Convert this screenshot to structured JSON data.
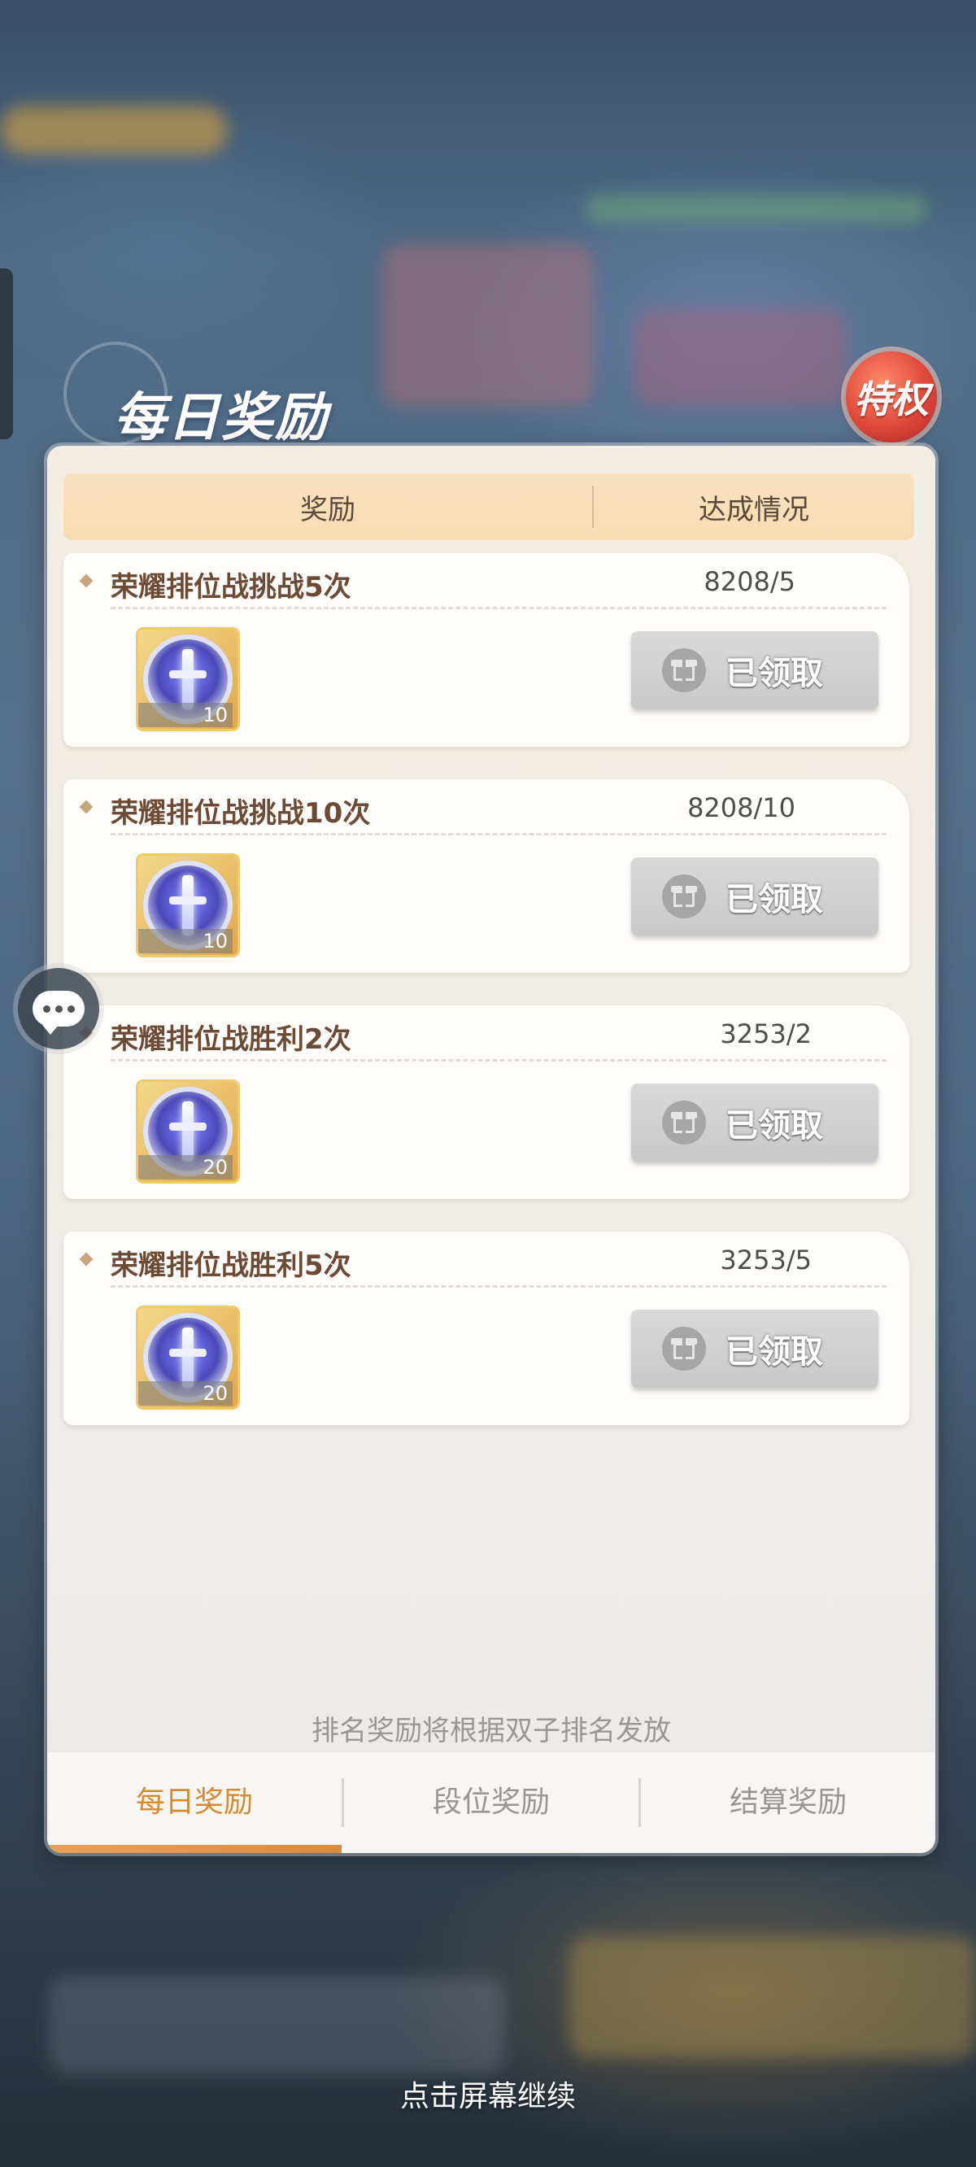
{
  "panel": {
    "title": "每日奖励",
    "privilege_badge": "特权",
    "header": {
      "reward": "奖励",
      "status": "达成情况"
    }
  },
  "tasks": [
    {
      "name": "荣耀排位战挑战5次",
      "progress": "8208/5",
      "reward_count": "10",
      "button": "已领取"
    },
    {
      "name": "荣耀排位战挑战10次",
      "progress": "8208/10",
      "reward_count": "10",
      "button": "已领取"
    },
    {
      "name": "荣耀排位战胜利2次",
      "progress": "3253/2",
      "reward_count": "20",
      "button": "已领取"
    },
    {
      "name": "荣耀排位战胜利5次",
      "progress": "3253/5",
      "reward_count": "20",
      "button": "已领取"
    }
  ],
  "hint": "排名奖励将根据双子排名发放",
  "tabs": [
    {
      "label": "每日奖励",
      "active": true
    },
    {
      "label": "段位奖励",
      "active": false
    },
    {
      "label": "结算奖励",
      "active": false
    }
  ],
  "continue_text": "点击屏幕继续",
  "icons": {
    "reward": "sword-coin-icon",
    "claim": "gift-icon",
    "chat": "chat-bubble-icon"
  },
  "colors": {
    "active_tab": "#d7892f",
    "header_bg": "#f8e2bf",
    "badge": "#e0483a"
  }
}
